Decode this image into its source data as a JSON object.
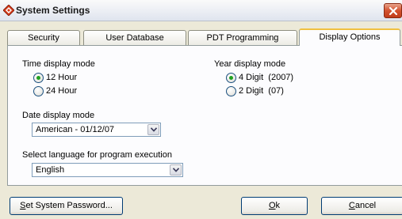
{
  "window": {
    "title": "System Settings",
    "icon": "app-diamond-icon",
    "close_icon": "close-x-icon"
  },
  "tabs": [
    {
      "label": "Security",
      "active": false
    },
    {
      "label": "User Database",
      "active": false
    },
    {
      "label": "PDT Programming",
      "active": false
    },
    {
      "label": "Display Options",
      "active": true
    }
  ],
  "time_display": {
    "label": "Time display mode",
    "options": [
      {
        "label": "12 Hour",
        "selected": true
      },
      {
        "label": "24 Hour",
        "selected": false
      }
    ]
  },
  "year_display": {
    "label": "Year display mode",
    "options": [
      {
        "label": "4 Digit  (2007)",
        "selected": true
      },
      {
        "label": "2 Digit  (07)",
        "selected": false
      }
    ]
  },
  "date_display": {
    "label": "Date display mode",
    "value": "American - 01/12/07"
  },
  "language": {
    "label": "Select language for program execution",
    "value": "English"
  },
  "buttons": {
    "set_password": {
      "underline": "S",
      "rest": "et System Password..."
    },
    "ok": {
      "underline": "O",
      "rest": "k"
    },
    "cancel": {
      "underline": "C",
      "rest": "ancel"
    }
  },
  "colors": {
    "radio_dot": "#21a121",
    "active_tab_accent": "#f0c040",
    "close_button": "#d3512e"
  }
}
